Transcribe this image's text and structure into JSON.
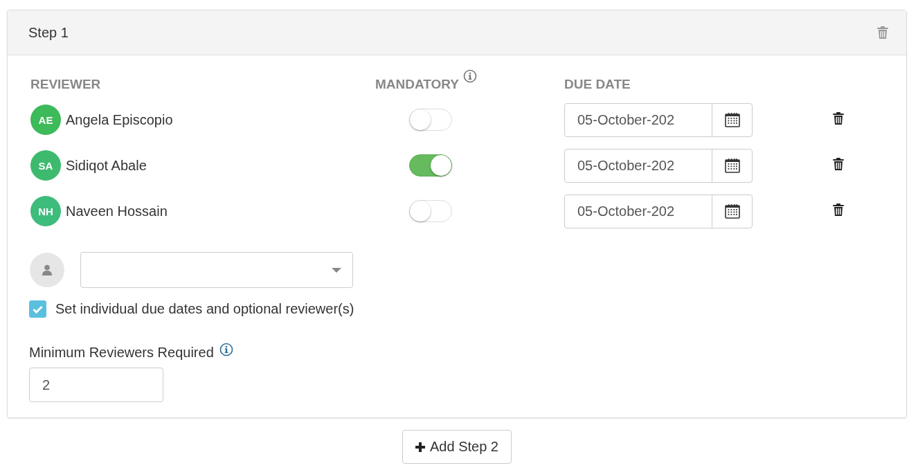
{
  "step": {
    "title": "Step 1",
    "columns": [
      "REVIEWER",
      "MANDATORY",
      "DUE DATE"
    ],
    "reviewers": [
      {
        "initials": "AE",
        "name": "Angela Episcopio",
        "color": "#3dba5a",
        "mandatory": false,
        "due_date": "05-October-202"
      },
      {
        "initials": "SA",
        "name": "Sidiqot Abale",
        "color": "#3dba6e",
        "mandatory": true,
        "due_date": "05-October-202"
      },
      {
        "initials": "NH",
        "name": "Naveen Hossain",
        "color": "#3dbc7c",
        "mandatory": false,
        "due_date": "05-October-202"
      }
    ],
    "individual_dates": {
      "label": "Set individual due dates and optional reviewer(s)",
      "checked": true
    },
    "minimum": {
      "label": "Minimum Reviewers Required",
      "value": "2"
    }
  },
  "add_step_button": "Add Step 2"
}
